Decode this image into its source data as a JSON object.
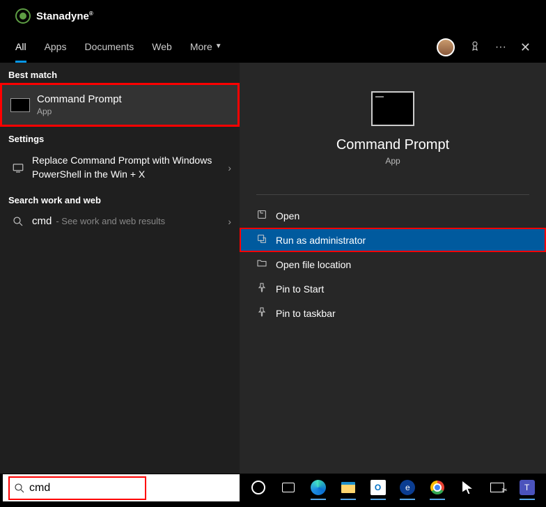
{
  "brand": {
    "name": "Stanadyne"
  },
  "tabs": {
    "items": [
      "All",
      "Apps",
      "Documents",
      "Web",
      "More"
    ],
    "active": 0
  },
  "results": {
    "best_match_label": "Best match",
    "best_match": {
      "title": "Command Prompt",
      "subtitle": "App"
    },
    "settings_label": "Settings",
    "settings_item": {
      "title": "Replace Command Prompt with Windows PowerShell in the Win + X"
    },
    "web_label": "Search work and web",
    "web_item": {
      "query": "cmd",
      "hint": "- See work and web results"
    }
  },
  "preview": {
    "title": "Command Prompt",
    "subtitle": "App",
    "actions": {
      "open": "Open",
      "run_admin": "Run as administrator",
      "open_location": "Open file location",
      "pin_start": "Pin to Start",
      "pin_taskbar": "Pin to taskbar"
    }
  },
  "search": {
    "value": "cmd"
  },
  "taskbar": {
    "outlook": "O",
    "eap": "e",
    "teams": "T"
  }
}
